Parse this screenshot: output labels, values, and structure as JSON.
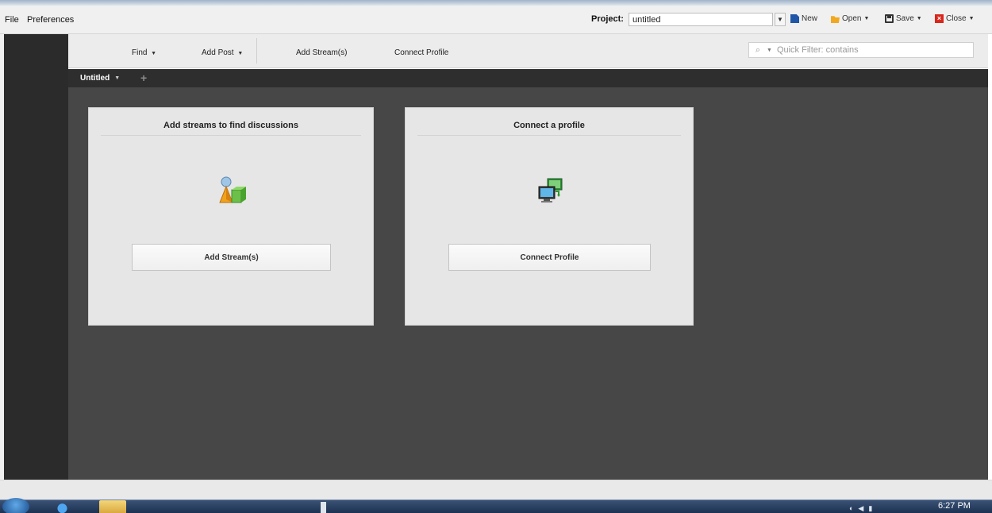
{
  "menubar": {
    "file_label": "File",
    "preferences_label": "Preferences",
    "project_label": "Project:",
    "project_value": "untitled",
    "new_label": "New",
    "open_label": "Open",
    "save_label": "Save",
    "close_label": "Close"
  },
  "toolbar": {
    "find_label": "Find",
    "add_post_label": "Add Post",
    "add_streams_label": "Add Stream(s)",
    "connect_profile_label": "Connect Profile",
    "quick_filter_placeholder": "Quick Filter: contains"
  },
  "tabs": [
    {
      "label": "Untitled"
    }
  ],
  "cards": {
    "streams": {
      "title": "Add streams to find discussions",
      "button_label": "Add Stream(s)",
      "icon": "streams-icon"
    },
    "profile": {
      "title": "Connect a profile",
      "button_label": "Connect Profile",
      "icon": "connect-profile-icon"
    }
  },
  "taskbar": {
    "clock": "6:27 PM"
  },
  "colors": {
    "content_bg": "#474747",
    "left_rail": "#2b2b2b",
    "card_bg": "#e6e6e6",
    "close_icon": "#d9261c",
    "new_icon": "#1f56a8",
    "open_icon": "#f1a81f"
  }
}
